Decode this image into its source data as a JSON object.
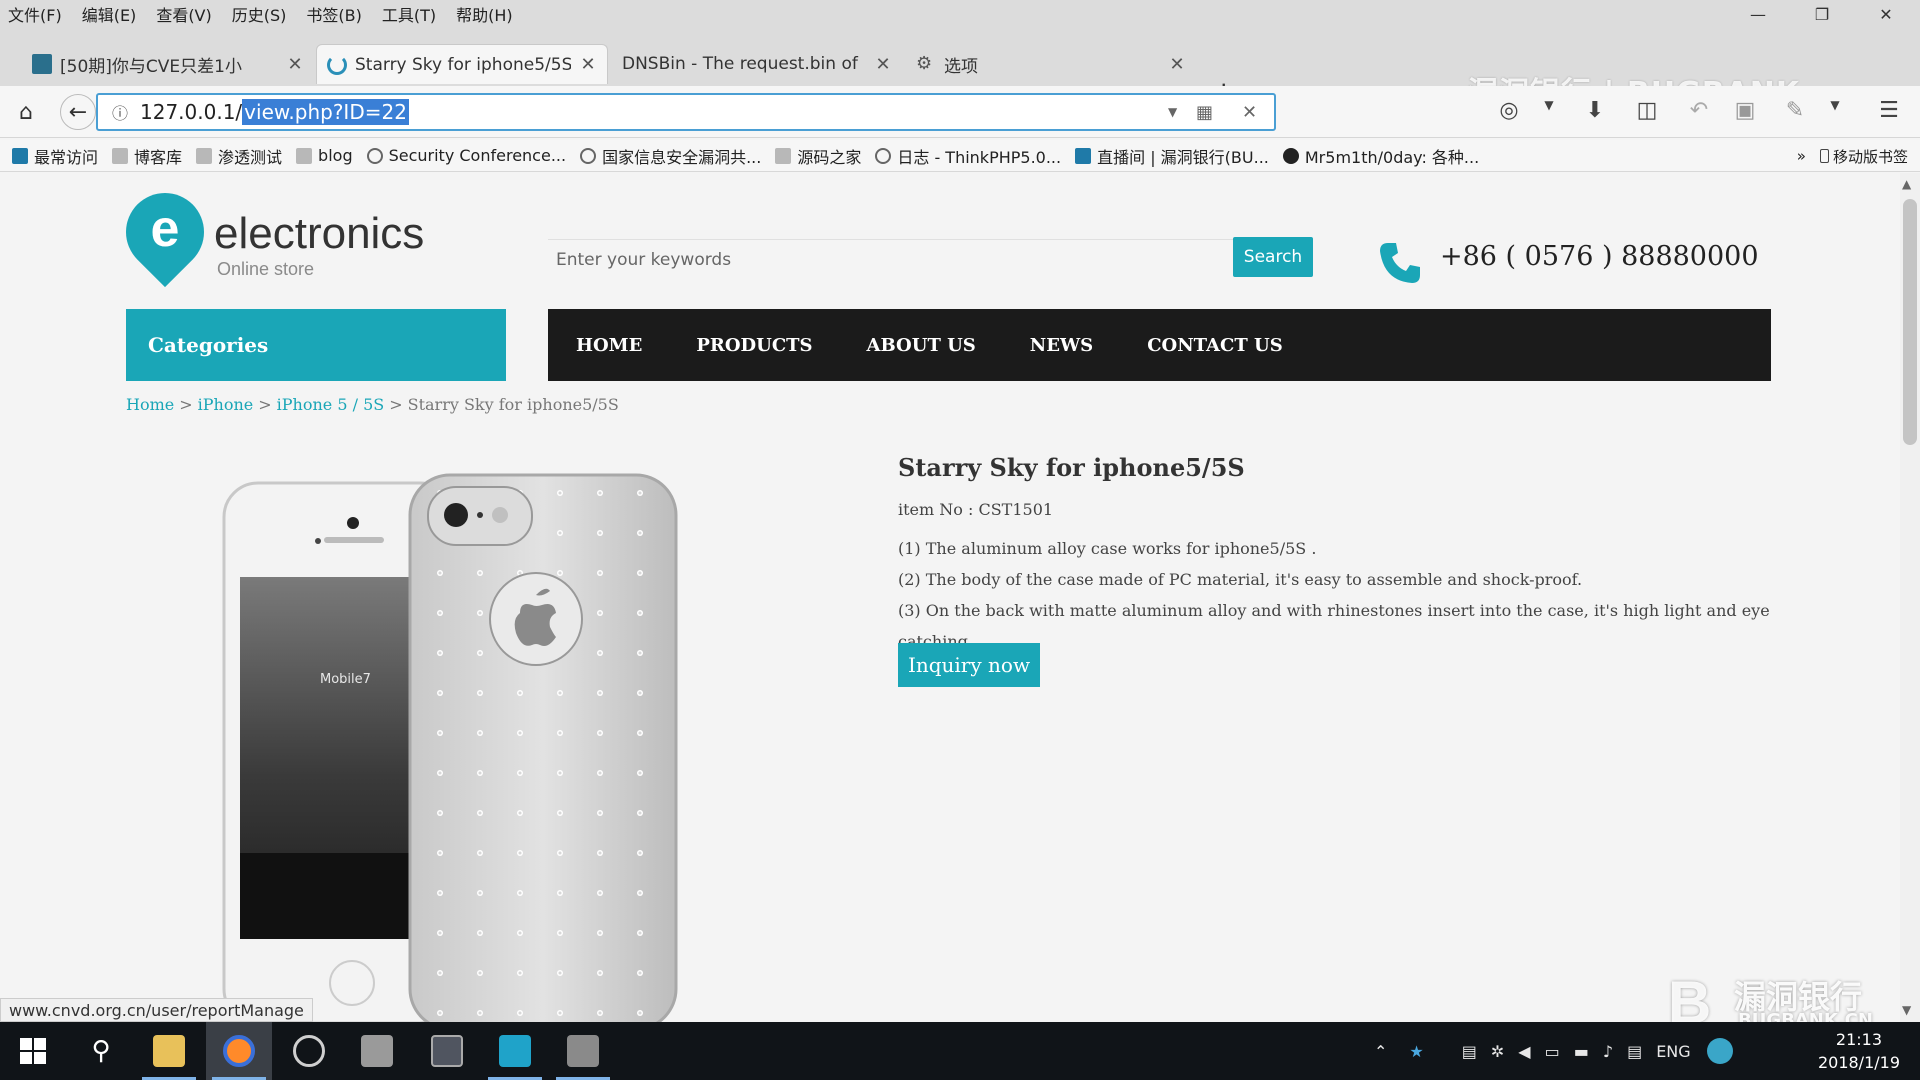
{
  "window": {
    "menus": [
      "文件(F)",
      "编辑(E)",
      "查看(V)",
      "历史(S)",
      "书签(B)",
      "工具(T)",
      "帮助(H)"
    ],
    "controls": {
      "minimize": "—",
      "restore": "❐",
      "close": "✕"
    }
  },
  "tabs": [
    {
      "title": "[50期]你与CVE只差1小",
      "icon": "book-icon",
      "active": false
    },
    {
      "title": "Starry Sky for iphone5/5S",
      "icon": "loading-icon",
      "active": true
    },
    {
      "title": "DNSBin - The request.bin of",
      "icon": "none",
      "active": false
    },
    {
      "title": "选项",
      "icon": "gear-icon",
      "active": false
    }
  ],
  "tab_close_glyph": "✕",
  "new_tab_glyph": "+",
  "watermark_top": "漏洞银行 | BUGBANK",
  "address": {
    "host": "127.0.0.1/",
    "selected_path": "view.php?ID=22"
  },
  "bookmarks": [
    {
      "label": "最常访问",
      "icon": "blue"
    },
    {
      "label": "博客库",
      "icon": "folder"
    },
    {
      "label": "渗透测试",
      "icon": "folder"
    },
    {
      "label": "blog",
      "icon": "folder"
    },
    {
      "label": "Security Conference...",
      "icon": "globe"
    },
    {
      "label": "国家信息安全漏洞共...",
      "icon": "globe"
    },
    {
      "label": "源码之家",
      "icon": "folder"
    },
    {
      "label": "日志 - ThinkPHP5.0...",
      "icon": "globe"
    },
    {
      "label": "直播间 | 漏洞银行(BU...",
      "icon": "blue"
    },
    {
      "label": "Mr5m1th/0day: 各种...",
      "icon": "gh"
    }
  ],
  "bookmarks_more": "»",
  "mobile_bookmarks": "移动版书签",
  "site": {
    "logo_letter": "e",
    "brand": "electronics",
    "tagline": "Online store",
    "search_placeholder": "Enter your keywords",
    "search_button": "Search",
    "phone": "+86 ( 0576 ) 88880000",
    "categories": "Categories",
    "nav": [
      "HOME",
      "PRODUCTS",
      "ABOUT US",
      "NEWS",
      "CONTACT US"
    ],
    "breadcrumb": [
      "Home",
      "iPhone",
      "iPhone 5 / 5S"
    ],
    "breadcrumb_current": "Starry Sky for iphone5/5S",
    "breadcrumb_sep": ">",
    "accent_color": "#1aa6b7",
    "nav_bg": "#1b1b1b"
  },
  "product": {
    "title": "Starry Sky for iphone5/5S",
    "item_no": "item No : CST1501",
    "features": [
      "(1) The aluminum alloy case works for iphone5/5S .",
      "(2) The body of the case made of PC material, it's easy to assemble and shock-proof.",
      "(3) On the back with matte aluminum alloy and with rhinestones insert into the case, it's high light and eye catching."
    ],
    "inquiry_button": "Inquiry now",
    "phone_screen_text": "Mobile7"
  },
  "status_url": "www.cnvd.org.cn/user/reportManage",
  "watermark_br": {
    "mark": "B",
    "title": "漏洞银行",
    "sub": "BUGBANK.CN"
  },
  "taskbar": {
    "tray_lang": "ENG",
    "time": "21:13",
    "date": "2018/1/19"
  }
}
